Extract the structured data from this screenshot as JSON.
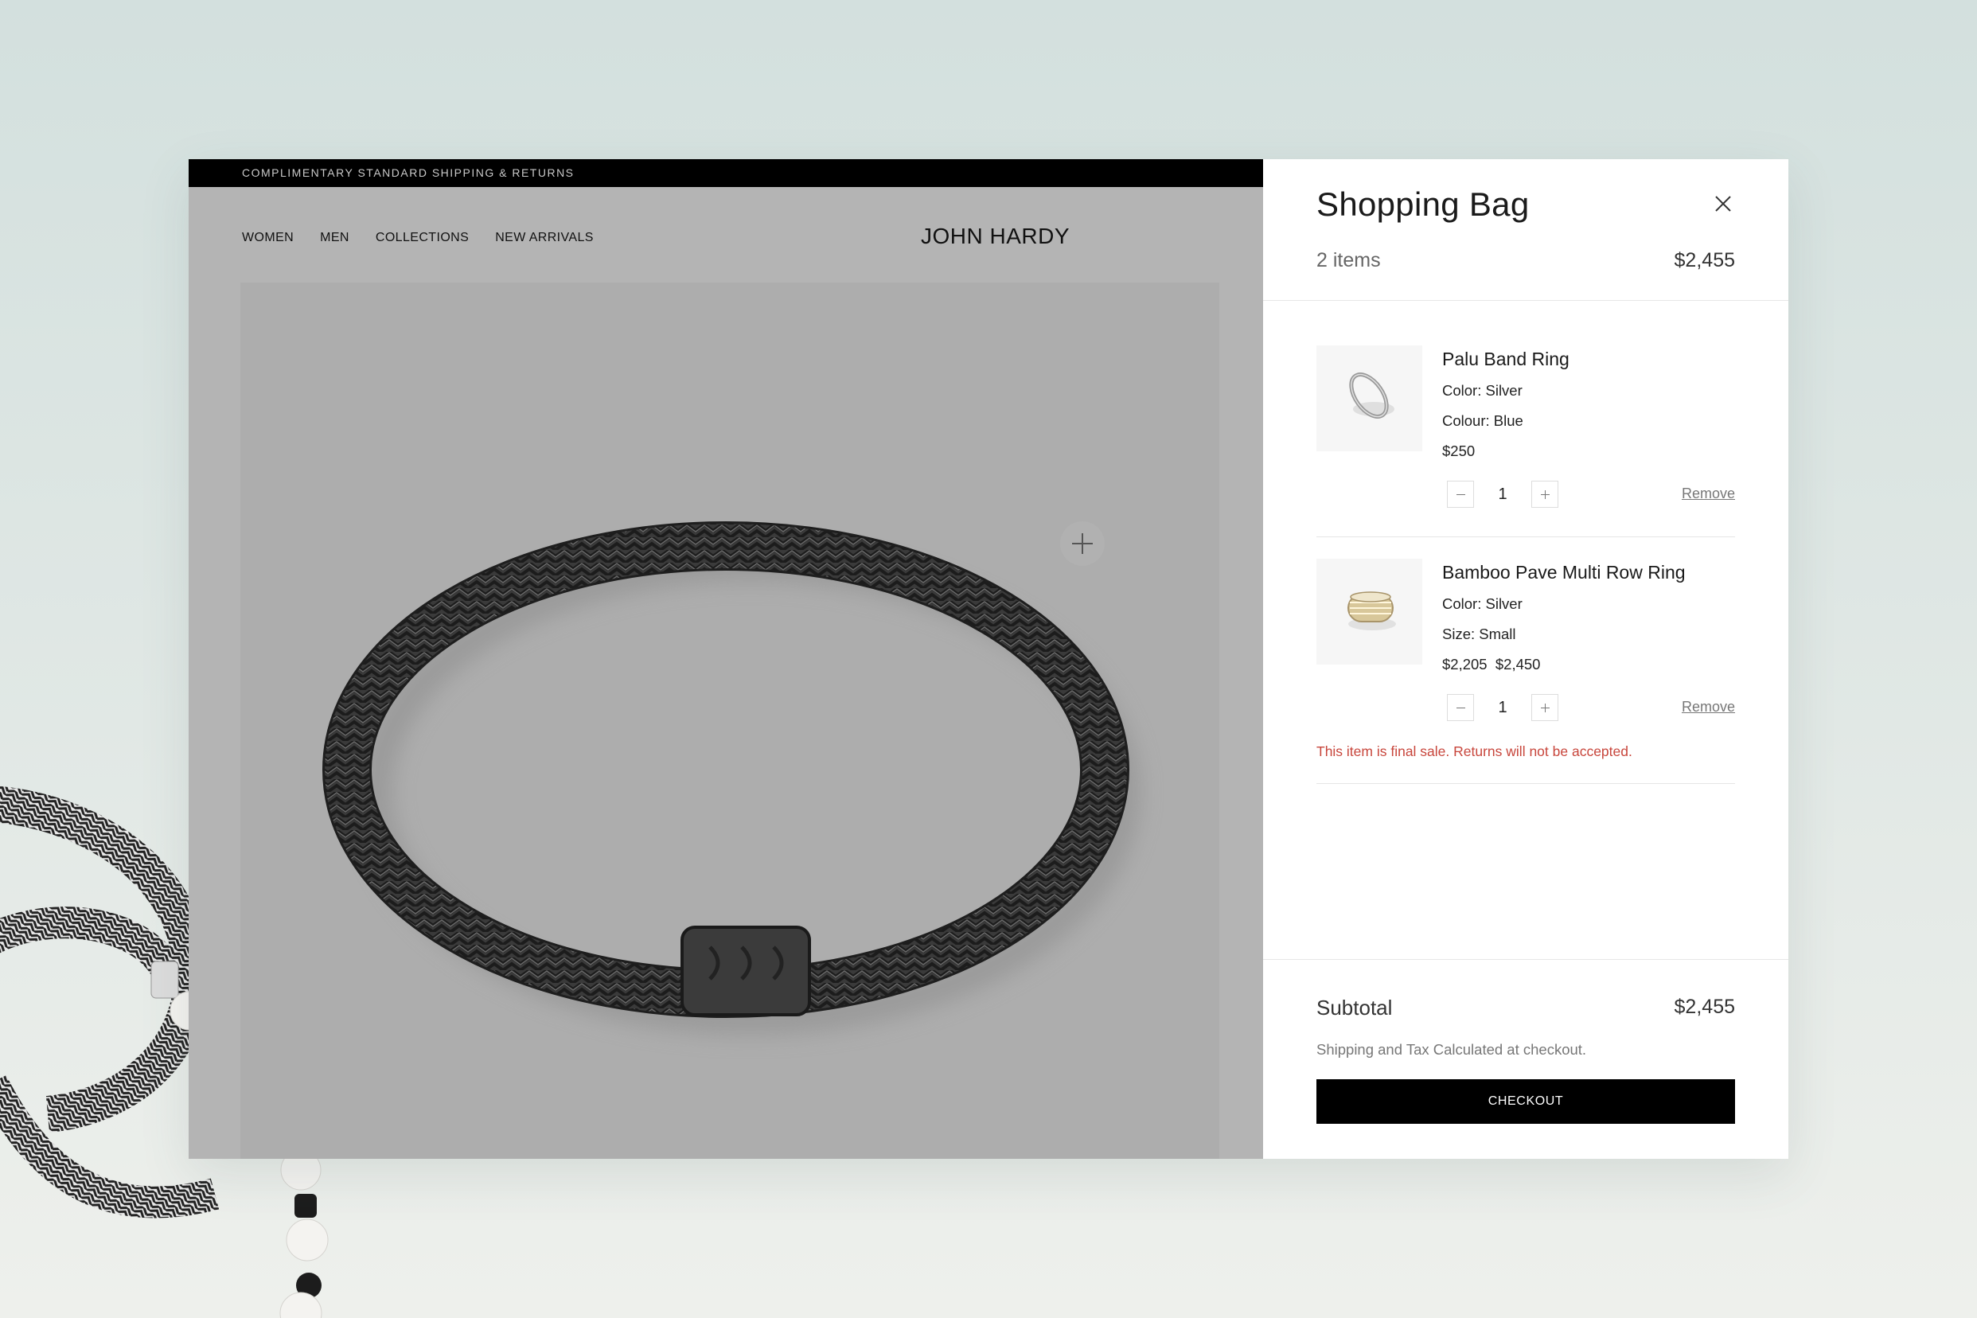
{
  "site": {
    "promo_bar": "COMPLIMENTARY STANDARD SHIPPING & RETURNS",
    "nav": [
      "WOMEN",
      "MEN",
      "COLLECTIONS",
      "NEW ARRIVALS"
    ],
    "logo": "JOHN HARDY",
    "hero_icon": "zoom-plus-icon"
  },
  "bag": {
    "title": "Shopping Bag",
    "count_label": "2 items",
    "total": "$2,455",
    "close_icon": "close-icon",
    "items": [
      {
        "name": "Palu Band Ring",
        "attributes": [
          "Color: Silver",
          "Colour: Blue"
        ],
        "price": "$250",
        "quantity": "1",
        "remove_label": "Remove"
      },
      {
        "name": "Bamboo Pave Multi Row Ring",
        "attributes": [
          "Color: Silver",
          "Size: Small"
        ],
        "price": "$2,205",
        "original_price": "$2,450",
        "quantity": "1",
        "remove_label": "Remove",
        "notice": "This item is final sale. Returns will not be accepted."
      }
    ],
    "subtotal_label": "Subtotal",
    "subtotal_value": "$2,455",
    "shipping_note": "Shipping and Tax Calculated at checkout.",
    "checkout_label": "CHECKOUT"
  },
  "colors": {
    "accent": "#000000",
    "notice": "#c8463c",
    "backdrop": "#d3e0de"
  }
}
